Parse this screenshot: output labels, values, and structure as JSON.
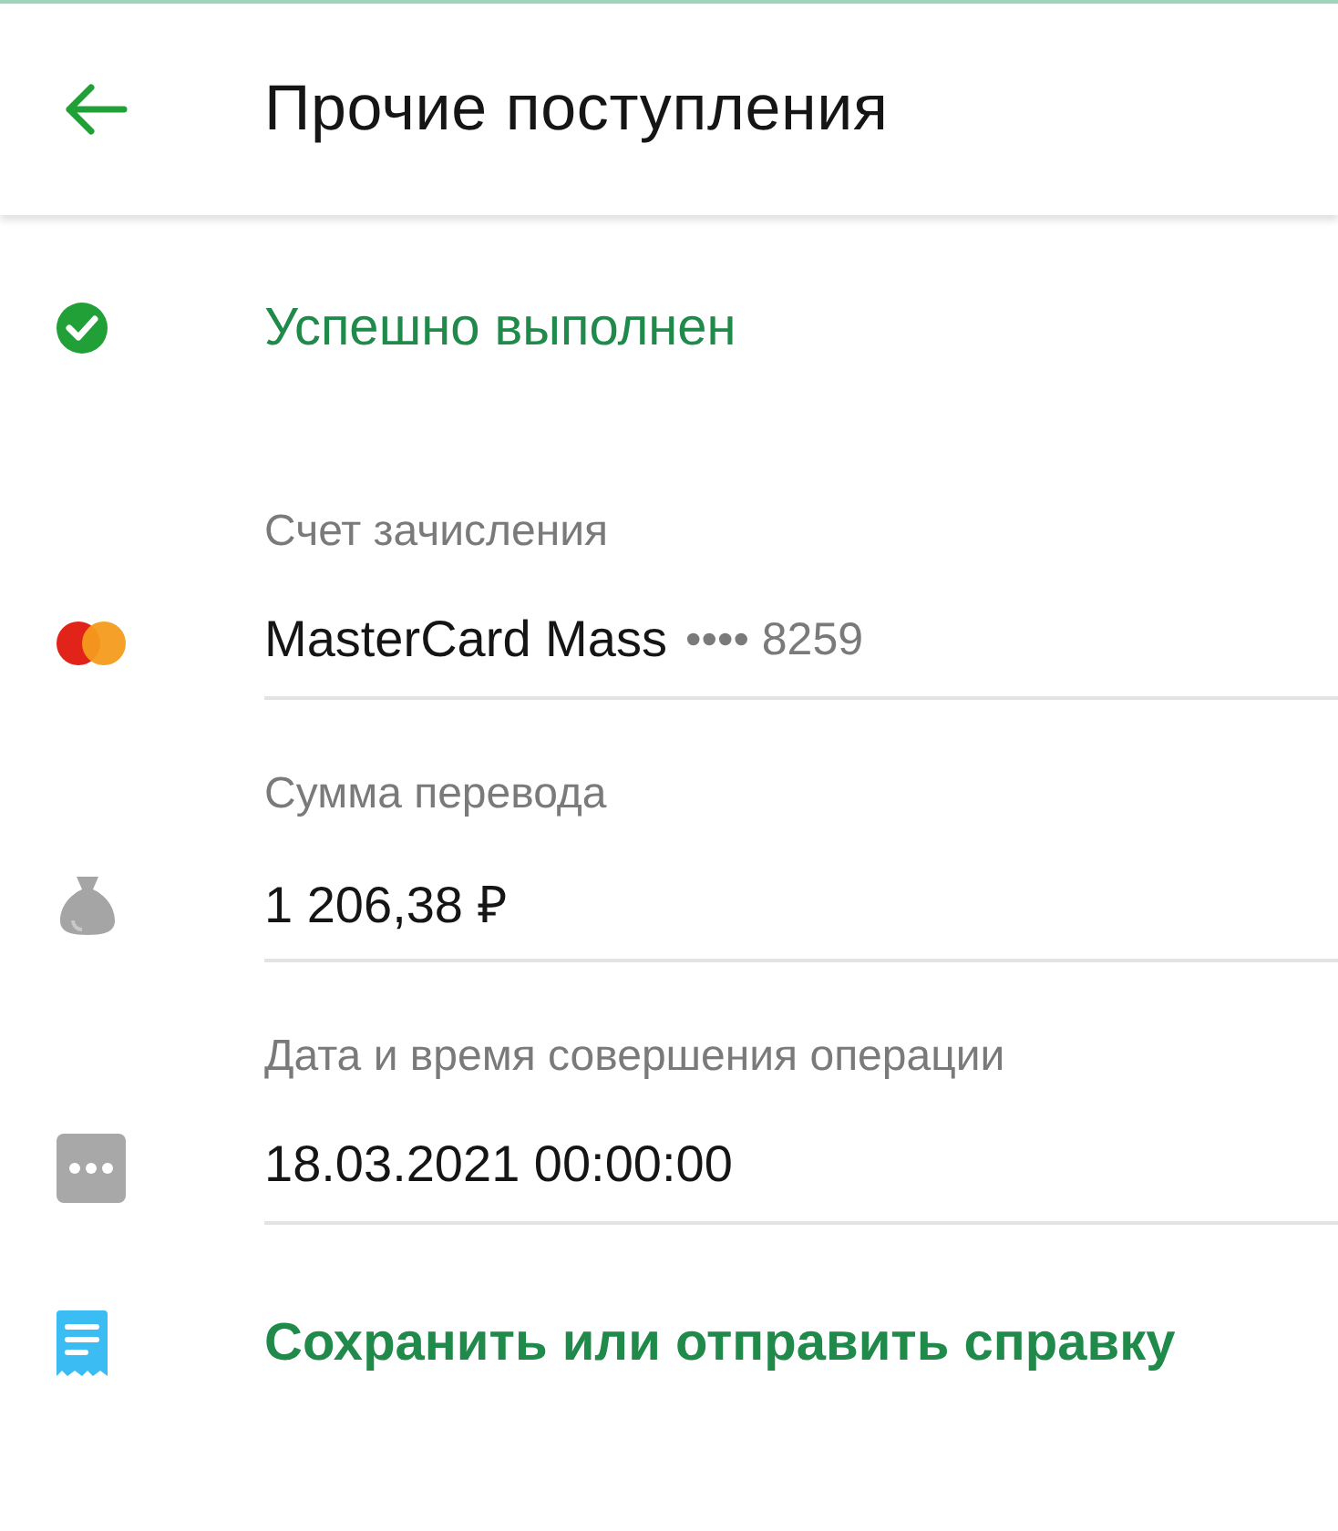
{
  "header": {
    "title": "Прочие поступления"
  },
  "status": {
    "kind": "success",
    "text": "Успешно выполнен"
  },
  "fields": [
    {
      "kind": "card",
      "label": "Счет зачисления",
      "value": "MasterCard Mass",
      "number": "•••• 8259"
    },
    {
      "kind": "amount",
      "label": "Сумма перевода",
      "value": "1 206,38 ₽"
    },
    {
      "kind": "datetime",
      "label": "Дата и время совершения операции",
      "value": "18.03.2021 00:00:00"
    }
  ],
  "action": {
    "text": "Сохранить или отправить справку"
  }
}
